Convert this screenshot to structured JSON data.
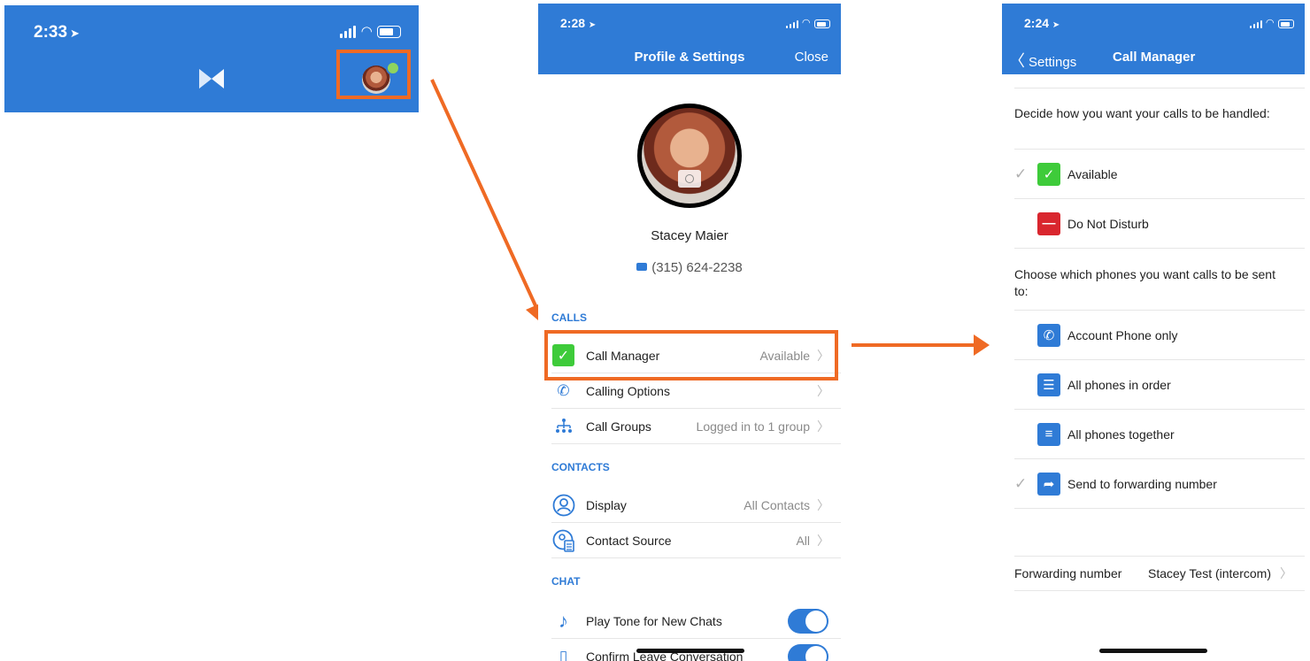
{
  "screen1": {
    "time": "2:33",
    "location_arrow": "➤",
    "logo_icon": "m-logo-icon",
    "highlight_color": "#ef6a24"
  },
  "screen2": {
    "time": "2:28",
    "title": "Profile & Settings",
    "close_label": "Close",
    "profile_name": "Stacey Maier",
    "profile_phone": "(315) 624-2238",
    "sections": {
      "calls": "CALLS",
      "contacts": "CONTACTS",
      "chat": "CHAT"
    },
    "rows": {
      "call_manager": {
        "label": "Call Manager",
        "value": "Available"
      },
      "calling_options": {
        "label": "Calling Options",
        "value": ""
      },
      "call_groups": {
        "label": "Call Groups",
        "value": "Logged in to 1 group"
      },
      "display": {
        "label": "Display",
        "value": "All Contacts"
      },
      "contact_source": {
        "label": "Contact Source",
        "value": "All"
      },
      "play_tone": {
        "label": "Play Tone for New Chats",
        "enabled": true
      },
      "confirm_leave": {
        "label": "Confirm Leave Conversation",
        "enabled": true
      }
    }
  },
  "screen3": {
    "time": "2:24",
    "back_label": "Settings",
    "title": "Call Manager",
    "desc1": "Decide how you want your calls to be handled:",
    "status_options": [
      {
        "label": "Available",
        "checked": true,
        "color": "#3ecb3a"
      },
      {
        "label": "Do Not Disturb",
        "checked": false,
        "color": "#d9262e"
      }
    ],
    "desc2": "Choose which phones you want calls to be sent to:",
    "routing_options": [
      {
        "label": "Account Phone only",
        "checked": false
      },
      {
        "label": "All phones in order",
        "checked": false
      },
      {
        "label": "All phones together",
        "checked": false
      },
      {
        "label": "Send to forwarding number",
        "checked": true
      }
    ],
    "forwarding": {
      "label": "Forwarding number",
      "value": "Stacey Test (intercom)"
    }
  },
  "colors": {
    "brand_blue": "#2f7bd6",
    "highlight_orange": "#ef6a24",
    "available_green": "#3ecb3a",
    "dnd_red": "#d9262e"
  }
}
